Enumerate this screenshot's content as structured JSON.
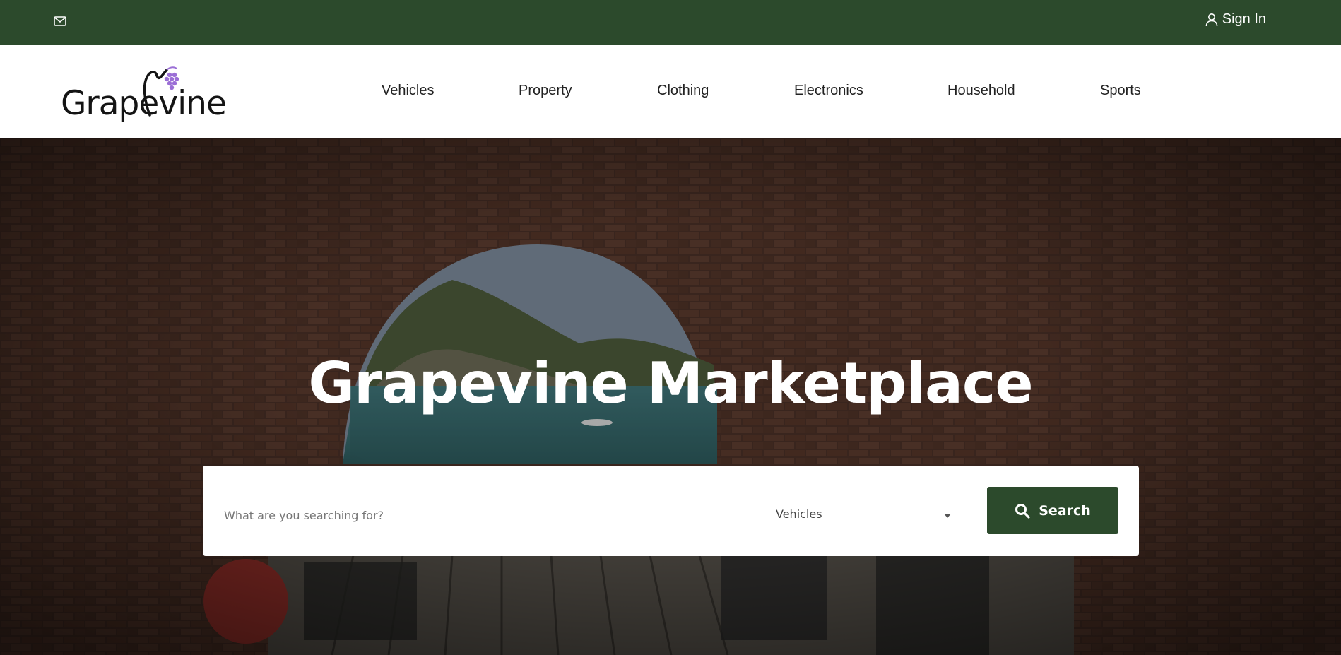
{
  "colors": {
    "brand_green": "#2c4a2c",
    "grape_purple": "#9b6fd6"
  },
  "topbar": {
    "mail_icon": "mail-icon",
    "signin_label": "Sign In",
    "user_icon": "user-icon"
  },
  "header": {
    "logo_text": "Grapevine",
    "nav": [
      "Vehicles",
      "Property",
      "Clothing",
      "Electronics",
      "Household",
      "Sports"
    ]
  },
  "hero": {
    "title": "Grapevine Marketplace",
    "search": {
      "placeholder": "What are you searching for?",
      "category_selected": "Vehicles",
      "button_label": "Search",
      "button_icon": "search-icon"
    }
  }
}
